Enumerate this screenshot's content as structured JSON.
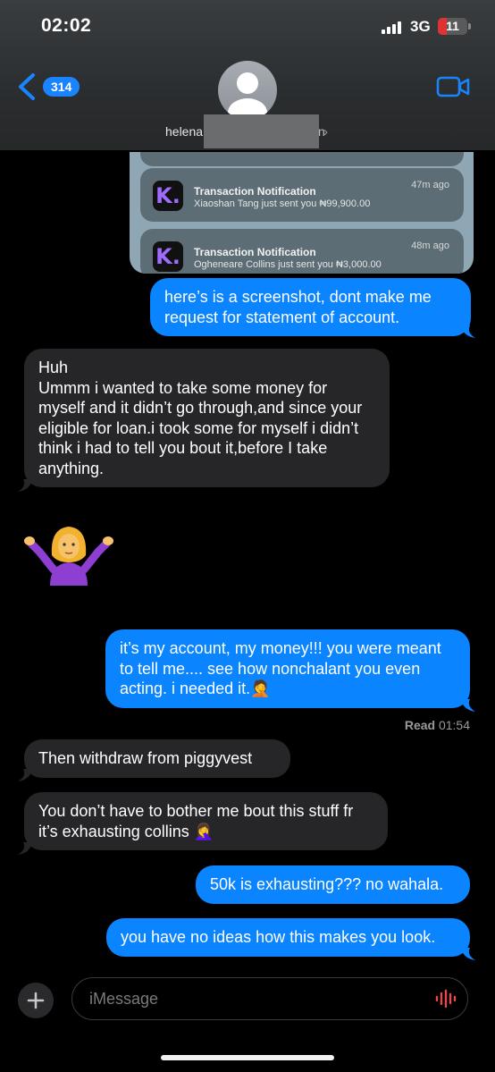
{
  "status_bar": {
    "time": "02:02",
    "network": "3G",
    "battery": "11",
    "battery_level": 0.11
  },
  "header": {
    "back_badge": "314",
    "contact_name_visible_start": "helena",
    "contact_name_visible_end": "n"
  },
  "screenshot": {
    "notifications": [
      {
        "title": "Transaction Notification",
        "body": "Xiaoshan  Tang just sent you ₦99,900.00",
        "time": "47m ago",
        "app_icon": "K."
      },
      {
        "title": "Transaction Notification",
        "body": "Ogheneare Collins just sent you ₦3,000.00",
        "time": "48m ago",
        "app_icon": "K."
      }
    ]
  },
  "messages": [
    {
      "side": "out",
      "text": "here’s is a screenshot, dont make me request for statement of account."
    },
    {
      "side": "in",
      "text": "Huh\nUmmm i wanted to take some money for myself and it didn’t go through,and since your eligible for loan.i took some for myself i didn’t think i had to tell you bout it,before I take anything."
    },
    {
      "side": "in",
      "text": "🤷‍♀️"
    },
    {
      "side": "out",
      "text": "it’s my account, my money!!! you were meant to tell me.... see how nonchalant you even acting.  i needed it.🤦"
    },
    {
      "side": "in",
      "text": "Then withdraw from piggyvest"
    },
    {
      "side": "in",
      "text": "You don’t have to bother me bout this stuff fr it’s exhausting collins 🤦‍♀️"
    },
    {
      "side": "out",
      "text": "50k is exhausting??? no wahala."
    },
    {
      "side": "out",
      "text": "you have no ideas how this makes you look."
    }
  ],
  "read_receipt": {
    "label": "Read",
    "time": "01:54"
  },
  "composer": {
    "placeholder": "iMessage"
  },
  "colors": {
    "outgoing": "#0a84ff",
    "incoming": "#262628",
    "background": "#000000"
  }
}
